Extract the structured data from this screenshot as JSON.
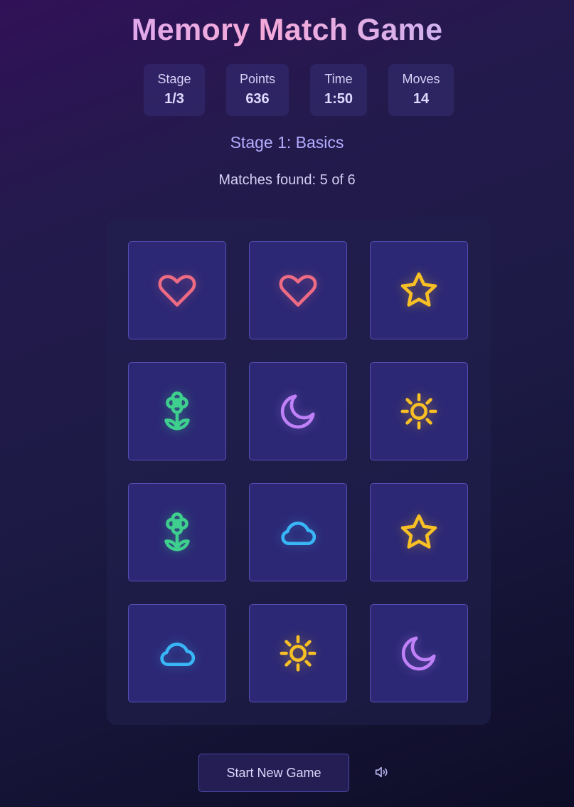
{
  "title": "Memory Match Game",
  "stats": {
    "stage": {
      "label": "Stage",
      "value": "1/3"
    },
    "points": {
      "label": "Points",
      "value": "636"
    },
    "time": {
      "label": "Time",
      "value": "1:50"
    },
    "moves": {
      "label": "Moves",
      "value": "14"
    }
  },
  "stage_name": "Stage 1: Basics",
  "matches_text": "Matches found: 5 of 6",
  "colors": {
    "heart": "#ee6b84",
    "star": "#f8c024",
    "flower": "#3ecf8e",
    "moon": "#c081f8",
    "sun": "#f8c024",
    "cloud": "#39b6f6"
  },
  "cards": [
    {
      "icon": "heart-icon"
    },
    {
      "icon": "heart-icon"
    },
    {
      "icon": "star-icon"
    },
    {
      "icon": "flower-icon"
    },
    {
      "icon": "moon-icon"
    },
    {
      "icon": "sun-icon"
    },
    {
      "icon": "flower-icon"
    },
    {
      "icon": "cloud-icon"
    },
    {
      "icon": "star-icon"
    },
    {
      "icon": "cloud-icon"
    },
    {
      "icon": "sun-icon"
    },
    {
      "icon": "moon-icon"
    }
  ],
  "new_game_label": "Start New Game",
  "sound_icon": "speaker-icon"
}
